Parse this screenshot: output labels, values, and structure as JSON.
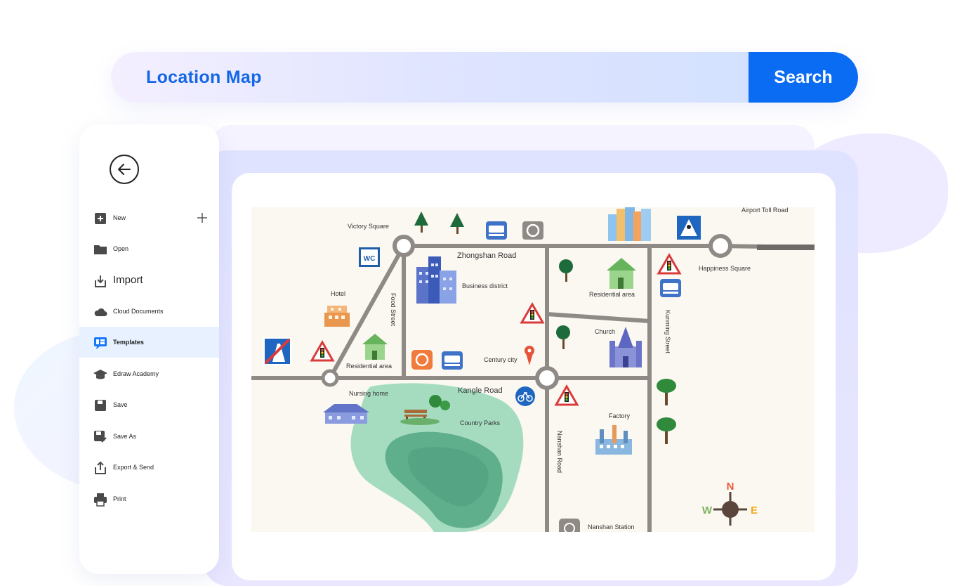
{
  "search": {
    "query": "Location Map",
    "button_label": "Search"
  },
  "sidebar": {
    "items": [
      {
        "label": "New",
        "icon": "new-icon"
      },
      {
        "label": "Open",
        "icon": "folder-icon"
      },
      {
        "label": "Import",
        "icon": "import-icon"
      },
      {
        "label": "Cloud Documents",
        "icon": "cloud-icon"
      },
      {
        "label": "Templates",
        "icon": "templates-icon"
      },
      {
        "label": "Edraw Academy",
        "icon": "academy-icon"
      },
      {
        "label": "Save",
        "icon": "save-icon"
      },
      {
        "label": "Save As",
        "icon": "save-as-icon"
      },
      {
        "label": "Export & Send",
        "icon": "export-icon"
      },
      {
        "label": "Print",
        "icon": "print-icon"
      }
    ],
    "active_item": "Templates"
  },
  "map": {
    "labels": {
      "victory_square": "Victory Square",
      "zhongshan_road": "Zhongshan Road",
      "airport_toll_road": "Airport Toll Road",
      "happiness_square": "Happiness Square",
      "hotel": "Hotel",
      "food_street": "Food Street",
      "business_district": "Business district",
      "residential_area_top": "Residential area",
      "residential_area_left": "Residential area",
      "kunming_street": "Kunming Street",
      "church": "Church",
      "century_city": "Century city",
      "nursing_home": "Nursing home",
      "kangle_road": "Kangle Road",
      "country_parks": "Country Parks",
      "factory": "Factory",
      "nanshan_road": "Nanshan Road",
      "nanshan_station": "Nanshan Station",
      "wc": "WC",
      "compass_n": "N",
      "compass_w": "W",
      "compass_e": "E"
    },
    "colors": {
      "road": "#8f8a86",
      "background": "#fbf8f1",
      "lake": "#5fae8c",
      "park": "#9fd7b8"
    }
  }
}
